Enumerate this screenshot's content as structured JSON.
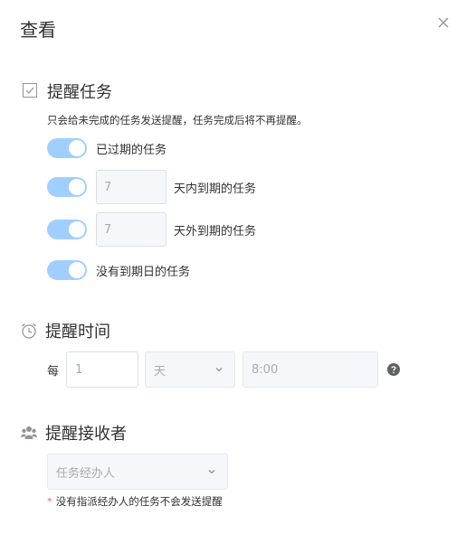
{
  "dialog": {
    "title": "查看"
  },
  "task_section": {
    "title": "提醒任务",
    "hint": "只会给未完成的任务发送提醒，任务完成后将不再提醒。",
    "options": [
      {
        "label": "已过期的任务",
        "enabled": true
      },
      {
        "value": "7",
        "label": "天内到期的任务",
        "enabled": true
      },
      {
        "value": "7",
        "label": "天外到期的任务",
        "enabled": true
      },
      {
        "label": "没有到期日的任务",
        "enabled": true
      }
    ]
  },
  "time_section": {
    "title": "提醒时间",
    "every_label": "每",
    "interval_value": "1",
    "unit": "天",
    "time": "8:00"
  },
  "receiver_section": {
    "title": "提醒接收者",
    "select_value": "任务经办人",
    "note_star": "*",
    "note": "没有指派经办人的任务不会发送提醒"
  },
  "colors": {
    "switch_on": "#a0cfff",
    "disabled_bg": "#f5f7fa",
    "required_star": "#f56c6c"
  }
}
